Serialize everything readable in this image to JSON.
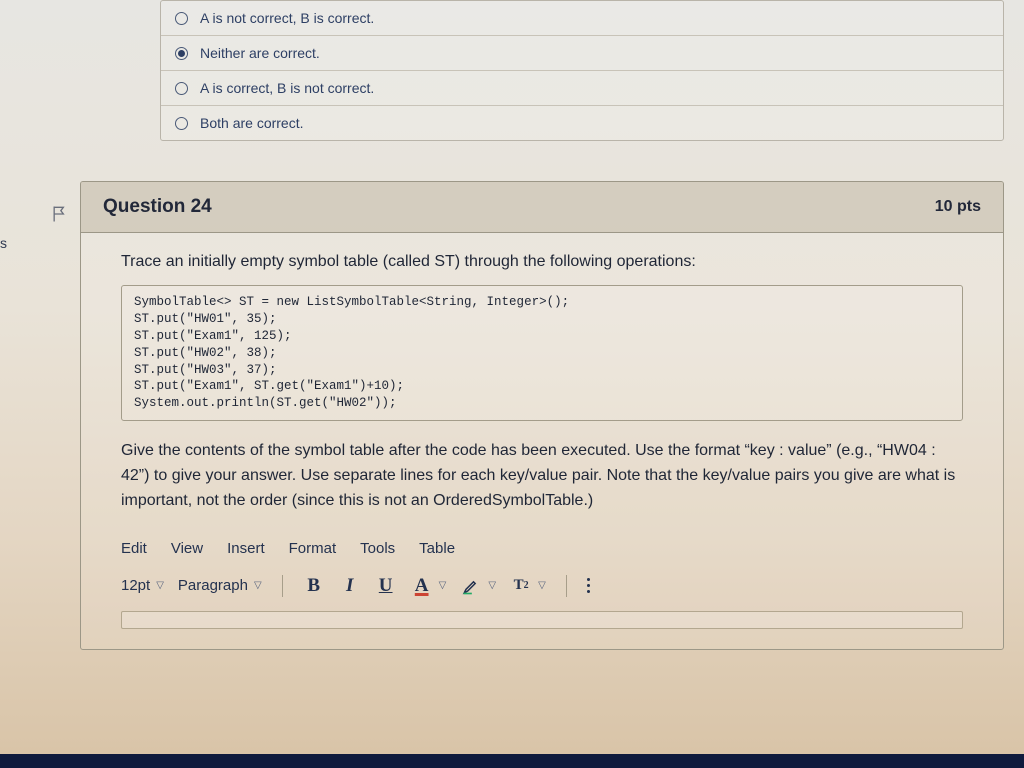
{
  "sidebar_frag": [
    "s",
    ""
  ],
  "prev_question": {
    "options": [
      {
        "label": "A is not correct, B is correct.",
        "selected": false
      },
      {
        "label": "Neither are correct.",
        "selected": true
      },
      {
        "label": "A is correct, B is not correct.",
        "selected": false
      },
      {
        "label": "Both are correct.",
        "selected": false
      }
    ]
  },
  "question": {
    "title": "Question 24",
    "points": "10 pts",
    "prompt": "Trace an initially empty symbol table (called ST) through the following operations:",
    "code": "SymbolTable<> ST = new ListSymbolTable<String, Integer>();\nST.put(\"HW01\", 35);\nST.put(\"Exam1\", 125);\nST.put(\"HW02\", 38);\nST.put(\"HW03\", 37);\nST.put(\"Exam1\", ST.get(\"Exam1\")+10);\nSystem.out.println(ST.get(\"HW02\"));",
    "instructions": "Give the contents of the symbol table after the code has been executed. Use the format “key : value” (e.g., “HW04 : 42”) to give your answer. Use separate lines for each key/value pair. Note that the key/value pairs you give are what is important, not the order (since this is not an OrderedSymbolTable.)"
  },
  "rte": {
    "menus": [
      "Edit",
      "View",
      "Insert",
      "Format",
      "Tools",
      "Table"
    ],
    "font_size": "12pt",
    "block": "Paragraph"
  }
}
